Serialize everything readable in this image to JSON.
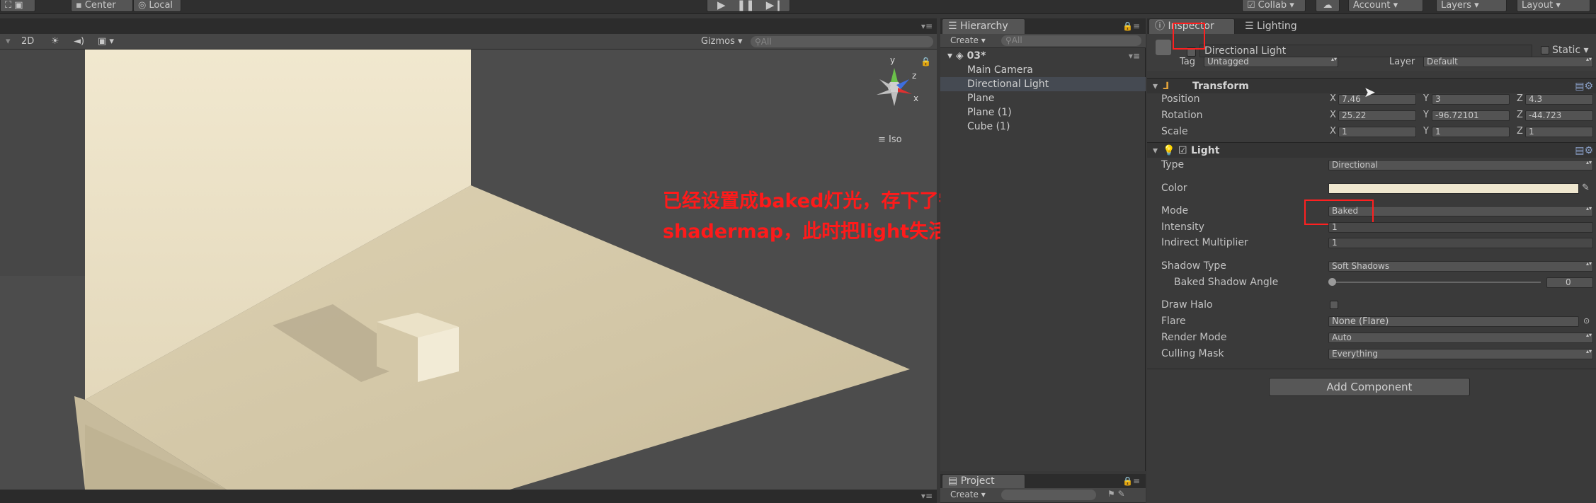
{
  "toolbar": {
    "pivot_label": "Center",
    "space_label": "Local",
    "collab_label": "Collab",
    "account_label": "Account",
    "layers_label": "Layers",
    "layout_label": "Layout"
  },
  "scene": {
    "mode_2d": "2D",
    "gizmos_label": "Gizmos",
    "search_placeholder": "All",
    "projection_label": "Iso",
    "gizmo_axes": {
      "x": "x",
      "y": "y",
      "z": "z"
    }
  },
  "hierarchy": {
    "tab_label": "Hierarchy",
    "create_label": "Create",
    "search_placeholder": "All",
    "scene_name": "03*",
    "items": [
      "Main Camera",
      "Directional Light",
      "Plane",
      "Plane (1)",
      "Cube (1)"
    ],
    "selected_index": 1
  },
  "project": {
    "tab_label": "Project",
    "create_label": "Create"
  },
  "inspector": {
    "tab_label": "Inspector",
    "lighting_tab_label": "Lighting",
    "object_name": "Directional Light",
    "static_label": "Static",
    "tag_label": "Tag",
    "tag_value": "Untagged",
    "layer_label": "Layer",
    "layer_value": "Default",
    "transform": {
      "title": "Transform",
      "position_label": "Position",
      "rotation_label": "Rotation",
      "scale_label": "Scale",
      "position": {
        "x": "7.46",
        "y": "3",
        "z": "4.3"
      },
      "rotation": {
        "x": "25.22",
        "y": "-96.72101",
        "z": "-44.723"
      },
      "scale": {
        "x": "1",
        "y": "1",
        "z": "1"
      },
      "axis_x": "X",
      "axis_y": "Y",
      "axis_z": "Z"
    },
    "light": {
      "title": "Light",
      "type_label": "Type",
      "type_value": "Directional",
      "color_label": "Color",
      "color_value": "#efe7cf",
      "mode_label": "Mode",
      "mode_value": "Baked",
      "intensity_label": "Intensity",
      "intensity_value": "1",
      "indirect_label": "Indirect Multiplier",
      "indirect_value": "1",
      "shadow_type_label": "Shadow Type",
      "shadow_type_value": "Soft Shadows",
      "baked_angle_label": "Baked Shadow Angle",
      "baked_angle_value": "0",
      "draw_halo_label": "Draw Halo",
      "flare_label": "Flare",
      "flare_value": "None (Flare)",
      "render_mode_label": "Render Mode",
      "render_mode_value": "Auto",
      "culling_label": "Culling Mask",
      "culling_value": "Everything"
    },
    "add_component_label": "Add Component"
  },
  "annotation": {
    "line1": "已经设置成baked灯光，存下了需要的",
    "line2": "shadermap，此时把light失活也可以正常显示",
    "color": "#ff1a1a"
  }
}
